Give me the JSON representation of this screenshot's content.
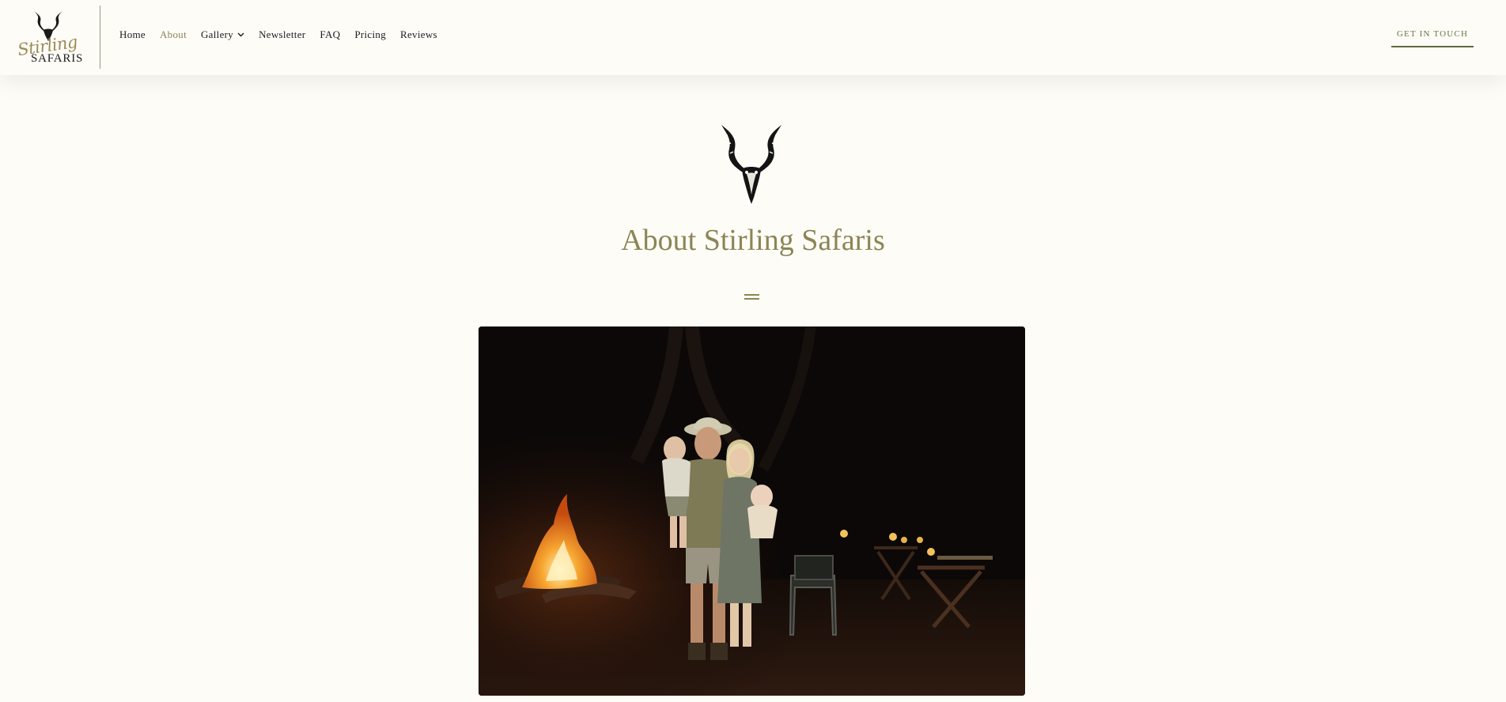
{
  "header": {
    "logo": {
      "script_text": "Stirling",
      "caps_text": "SAFARIS",
      "icon": "kudu-skull-icon"
    },
    "nav": [
      {
        "label": "Home",
        "active": false
      },
      {
        "label": "About",
        "active": true
      },
      {
        "label": "Gallery",
        "active": false,
        "has_dropdown": true,
        "dropdown_icon": "chevron-down-icon"
      },
      {
        "label": "Newsletter",
        "active": false
      },
      {
        "label": "FAQ",
        "active": false
      },
      {
        "label": "Pricing",
        "active": false
      },
      {
        "label": "Reviews",
        "active": false
      }
    ],
    "cta_label": "GET IN TOUCH"
  },
  "hero": {
    "emblem_icon": "kudu-skull-icon",
    "title": "About Stirling Safaris",
    "separator_icon": "double-line-icon",
    "photo_subject": "family-campfire-night-photo"
  },
  "colors": {
    "background": "#fdfcf7",
    "accent": "#8b8554",
    "cta": "#5f6a3e",
    "text": "#1c1c1c"
  }
}
